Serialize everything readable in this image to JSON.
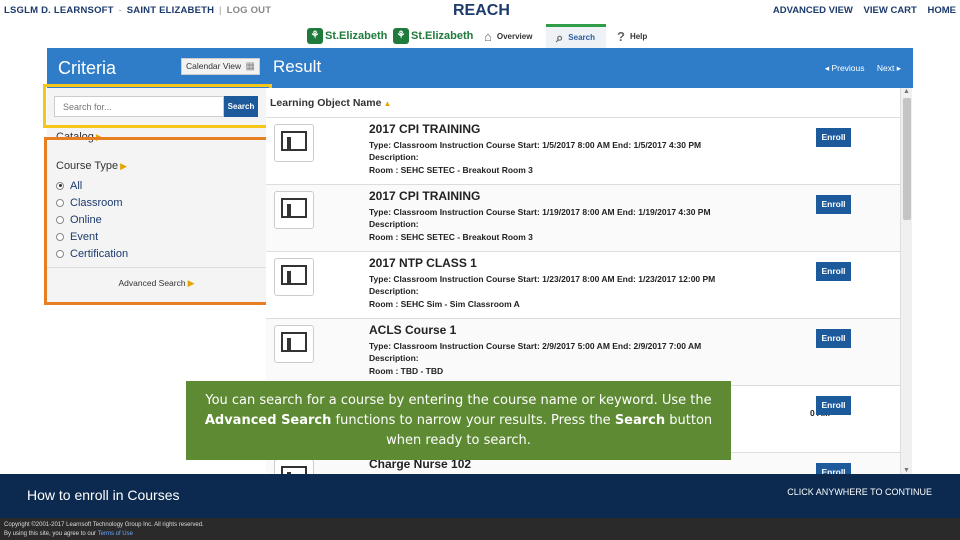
{
  "top": {
    "user": "LSGLM D. LEARNSOFT",
    "org": "SAINT ELIZABETH",
    "logout": "LOG OUT",
    "app_title": "REACH",
    "links": [
      "ADVANCED VIEW",
      "VIEW CART",
      "HOME"
    ],
    "logos": [
      "St.Elizabeth",
      "St.Elizabeth"
    ],
    "nav": {
      "overview": "Overview",
      "search": "Search",
      "help": "Help"
    }
  },
  "header": {
    "criteria": "Criteria",
    "calendar_view": "Calendar View",
    "result": "Result",
    "previous": "◂ Previous",
    "next": "Next ▸"
  },
  "left": {
    "search_placeholder": "Search for...",
    "search_button": "Search",
    "catalog": "Catalog",
    "course_type": "Course Type",
    "options": [
      "All",
      "Classroom",
      "Online",
      "Event",
      "Certification"
    ],
    "selected": "All",
    "advanced_search": "Advanced Search"
  },
  "results": {
    "column_header": "Learning Object Name",
    "enroll_label": "Enroll",
    "items": [
      {
        "title": "2017 CPI TRAINING",
        "type": "Type: Classroom Instruction Course Start: 1/5/2017 8:00 AM End: 1/5/2017 4:30 PM",
        "description": "Description:",
        "room": "Room : SEHC SETEC - Breakout Room 3"
      },
      {
        "title": "2017 CPI TRAINING",
        "type": "Type: Classroom Instruction Course Start: 1/19/2017 8:00 AM End: 1/19/2017 4:30 PM",
        "description": "Description:",
        "room": "Room : SEHC SETEC - Breakout Room 3"
      },
      {
        "title": "2017 NTP CLASS 1",
        "type": "Type: Classroom Instruction Course Start: 1/23/2017 8:00 AM End: 1/23/2017 12:00 PM",
        "description": "Description:",
        "room": "Room : SEHC Sim - Sim Classroom A"
      },
      {
        "title": "ACLS Course 1",
        "type": "Type: Classroom Instruction Course Start: 2/9/2017 5:00 AM End: 2/9/2017 7:00 AM",
        "description": "Description:",
        "room": "Room : TBD - TBD"
      },
      {
        "title": "",
        "type": "0 AM",
        "description": "",
        "room": ""
      },
      {
        "title": "Charge Nurse 102",
        "type": "",
        "description": "",
        "room": ""
      }
    ]
  },
  "tooltip": {
    "text1": "You can search for a course by entering the course name or keyword. Use the",
    "bold1": "Advanced Search",
    "text2": " functions to narrow your results. Press the ",
    "bold2": "Search",
    "text3": " button when ready to search."
  },
  "footer": {
    "title": "How to enroll in Courses",
    "cta": "CLICK ANYWHERE TO CONTINUE",
    "copyright": "Copyright ©2001-2017 Learnsoft Technology Group Inc. All rights reserved.",
    "terms_prefix": "By using this site, you agree to our ",
    "terms_link": "Terms of Use"
  }
}
